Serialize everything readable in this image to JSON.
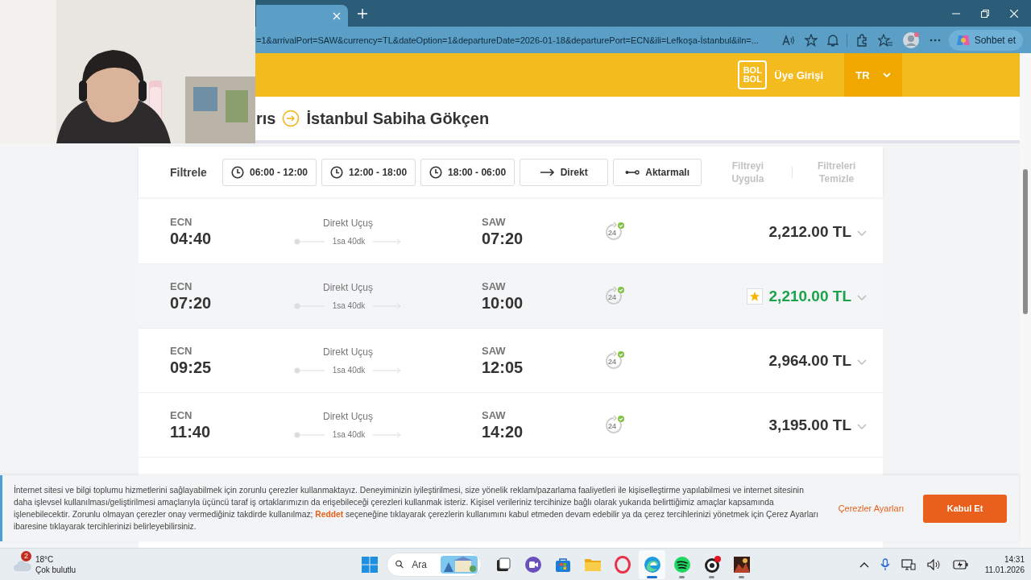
{
  "browser": {
    "url": "=1&arrivalPort=SAW&currency=TL&dateOption=1&departureDate=2026-01-18&departurePort=ECN&ili=Lefkoşa-İstanbul&iln=...",
    "copilot_label": "Sohbet et"
  },
  "header": {
    "logo_lines": [
      "BOL",
      "BOL"
    ],
    "login": "Üye Girişi",
    "language": "TR"
  },
  "route": {
    "origin": "rıs",
    "destination": "İstanbul Sabiha Gökçen"
  },
  "filters": {
    "label": "Filtrele",
    "options": [
      {
        "kind": "time",
        "label": "06:00 - 12:00"
      },
      {
        "kind": "time",
        "label": "12:00 - 18:00"
      },
      {
        "kind": "time",
        "label": "18:00 - 06:00"
      },
      {
        "kind": "direct",
        "label": "Direkt"
      },
      {
        "kind": "transfer",
        "label": "Aktarmalı"
      }
    ],
    "actions": [
      {
        "label": "Filtreyi Uygula",
        "disabled": true
      },
      {
        "label": "Filtreleri Temizle",
        "disabled": true
      }
    ]
  },
  "flights": [
    {
      "from": "ECN",
      "departure": "04:40",
      "type": "Direkt Uçuş",
      "duration": "1sa 40dk",
      "to": "SAW",
      "arrival": "07:20",
      "support_label": "24",
      "price": "2,212.00 TL",
      "best_price": false,
      "highlighted": false
    },
    {
      "from": "ECN",
      "departure": "07:20",
      "type": "Direkt Uçuş",
      "duration": "1sa 40dk",
      "to": "SAW",
      "arrival": "10:00",
      "support_label": "24",
      "price": "2,210.00 TL",
      "best_price": true,
      "highlighted": true
    },
    {
      "from": "ECN",
      "departure": "09:25",
      "type": "Direkt Uçuş",
      "duration": "1sa 40dk",
      "to": "SAW",
      "arrival": "12:05",
      "support_label": "24",
      "price": "2,964.00 TL",
      "best_price": false,
      "highlighted": false
    },
    {
      "from": "ECN",
      "departure": "11:40",
      "type": "Direkt Uçuş",
      "duration": "1sa 40dk",
      "to": "SAW",
      "arrival": "14:20",
      "support_label": "24",
      "price": "3,195.00 TL",
      "best_price": false,
      "highlighted": false
    }
  ],
  "cookie_banner": {
    "text_before": "İnternet sitesi ve bilgi toplumu hizmetlerini sağlayabilmek için zorunlu çerezler kullanmaktayız. Deneyiminizin iyileştirilmesi, size yönelik reklam/pazarlama faaliyetleri ile kişiselleştirme yapılabilmesi ve internet sitesinin daha işlevsel kullanılması/geliştirilmesi amaçlarıyla üçüncü taraf iş ortaklarımızın da erişebileceği çerezleri kullanmak isteriz. Kişisel verileriniz tercihinize bağlı olarak yukarıda belirttiğimiz amaçlar kapsamında işlenebilecektir. Zorunlu olmayan çerezler onay vermediğiniz takdirde kullanılmaz;",
    "link": "Reddet",
    "text_after": "seçeneğine tıklayarak çerezlerin kullanımını kabul etmeden devam edebilir ya da çerez tercihlerinizi yönetmek için Çerez Ayarları ibaresine tıklayarak tercihlerinizi belirleyebilirsiniz.",
    "settings_link": "Çerezler Ayarları",
    "accept_button": "Kabul Et"
  },
  "taskbar": {
    "weather": {
      "badge": "2",
      "temperature": "18°C",
      "condition": "Çok bulutlu"
    },
    "search_placeholder": "Ara",
    "apps": [
      {
        "kind": "taskview",
        "running": false,
        "active": false
      },
      {
        "kind": "chat",
        "running": false,
        "active": false
      },
      {
        "kind": "store",
        "running": false,
        "active": false
      },
      {
        "kind": "folder",
        "running": false,
        "active": false
      },
      {
        "kind": "ring",
        "running": false,
        "active": false
      },
      {
        "kind": "browser",
        "running": true,
        "active": true
      },
      {
        "kind": "music",
        "running": true,
        "active": false
      },
      {
        "kind": "recorder",
        "running": true,
        "active": false
      },
      {
        "kind": "game",
        "running": true,
        "active": false
      }
    ],
    "clock": {
      "time": "14:31",
      "date": "11.01.2026"
    }
  }
}
